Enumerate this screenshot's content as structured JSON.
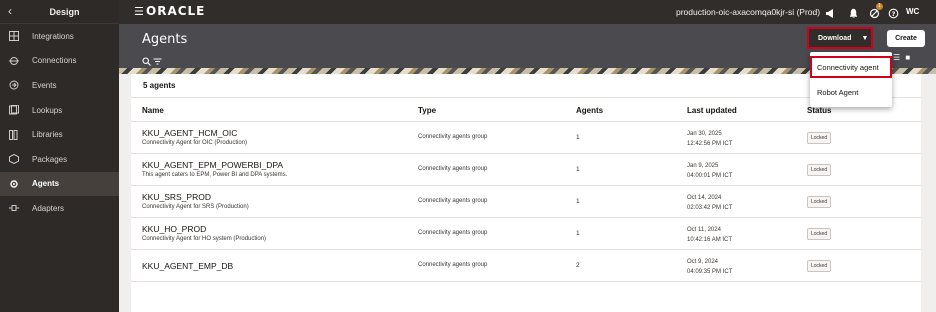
{
  "sidebar": {
    "back_label": "‹",
    "title": "Design",
    "items": [
      {
        "label": "Integrations",
        "icon": "integrations-icon"
      },
      {
        "label": "Connections",
        "icon": "connections-icon"
      },
      {
        "label": "Events",
        "icon": "events-icon"
      },
      {
        "label": "Lookups",
        "icon": "lookups-icon"
      },
      {
        "label": "Libraries",
        "icon": "libraries-icon"
      },
      {
        "label": "Packages",
        "icon": "packages-icon"
      },
      {
        "label": "Agents",
        "icon": "agents-icon",
        "active": true
      },
      {
        "label": "Adapters",
        "icon": "adapters-icon"
      }
    ]
  },
  "topbar": {
    "logo": "ORACLE",
    "environment": "production-oic-axacomqa0kjr-si (Prod)",
    "notification_count": "1",
    "avatar": "WC"
  },
  "header": {
    "title": "Agents",
    "download_label": "Download",
    "create_label": "Create"
  },
  "dropdown": {
    "items": [
      "Connectivity agent",
      "Robot Agent"
    ]
  },
  "table": {
    "count_label": "5 agents",
    "columns": [
      "Name",
      "Type",
      "Agents",
      "Last updated",
      "Status"
    ],
    "rows": [
      {
        "name": "KKU_AGENT_HCM_OIC",
        "desc": "Connectivity Agent for OIC (Production)",
        "type": "Connectivity agents group",
        "agents": "1",
        "date": "Jan 30, 2025",
        "time": "12:42:56 PM ICT",
        "status": "Locked"
      },
      {
        "name": "KKU_AGENT_EPM_POWERBI_DPA",
        "desc": "This agent caters to EPM, Power BI and DPA systems.",
        "type": "Connectivity agents group",
        "agents": "1",
        "date": "Jan 9, 2025",
        "time": "04:00:01 PM ICT",
        "status": "Locked"
      },
      {
        "name": "KKU_SRS_PROD",
        "desc": "Connectivity Agent for SRS (Production)",
        "type": "Connectivity agents group",
        "agents": "1",
        "date": "Oct 14, 2024",
        "time": "02:03:42 PM ICT",
        "status": "Locked"
      },
      {
        "name": "KKU_HO_PROD",
        "desc": "Connectivity Agent for HO system (Production)",
        "type": "Connectivity agents group",
        "agents": "1",
        "date": "Oct 11, 2024",
        "time": "10:42:16 AM ICT",
        "status": "Locked"
      },
      {
        "name": "KKU_AGENT_EMP_DB",
        "desc": "",
        "type": "Connectivity agents group",
        "agents": "2",
        "date": "Oct 9, 2024",
        "time": "04:09:35 PM ICT",
        "status": "Locked"
      }
    ]
  }
}
